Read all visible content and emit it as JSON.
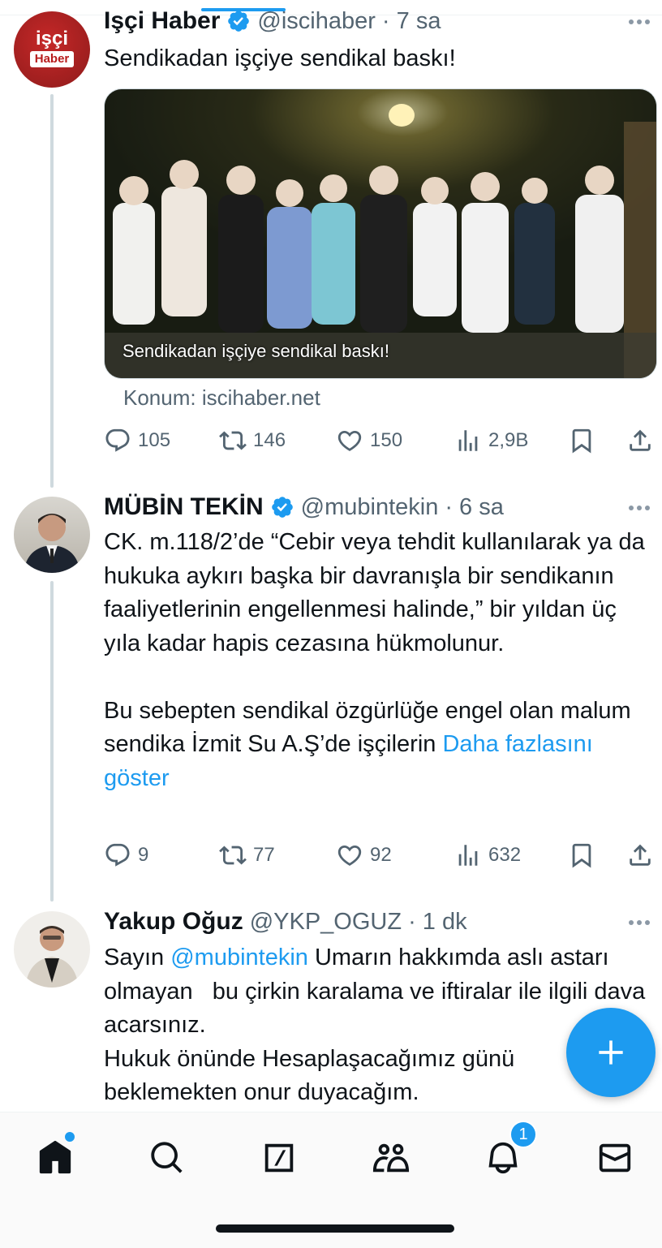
{
  "colors": {
    "accent": "#1d9bf0",
    "text": "#0f1419",
    "muted": "#536471",
    "verified": "#1d9bf0"
  },
  "tweets": [
    {
      "name": "Işçi Haber",
      "handle": "@iscihaber",
      "time": "· 7 sa",
      "avatar_text_1": "işçi",
      "avatar_text_2": "Haber",
      "text": "Sendikadan işçiye sendikal baskı!",
      "media_caption": "Sendikadan işçiye sendikal baskı!",
      "source": "Konum: iscihaber.net",
      "replies": "105",
      "retweets": "146",
      "likes": "150",
      "views": "2,9B"
    },
    {
      "name": "MÜBİN  TEKİN",
      "handle": "@mubintekin",
      "time": "· 6 sa",
      "text": "CK. m.118/2’de “Cebir veya tehdit kullanılarak ya da hukuka aykırı başka bir davranışla bir sendikanın faaliyetlerinin engellenmesi halinde,” bir yıldan üç yıla kadar hapis cezasına hükmolunur.\n\nBu sebepten sendikal özgürlüğe engel olan malum sendika İzmit Su A.Ş’de işçilerin ",
      "show_more": "Daha fazlasını göster",
      "replies": "9",
      "retweets": "77",
      "likes": "92",
      "views": "632"
    },
    {
      "name": "Yakup Oğuz",
      "handle": "@YKP_OGUZ",
      "time": "· 1 dk",
      "text_before": "Sayın ",
      "mention": "@mubintekin",
      "text_after": " Umarın hakkımda aslı astarı olmayan   bu çirkin karalama ve iftiralar ile ilgili dava acarsınız.\nHukuk önünde Hesaplaşacağımız günü beklemekten onur duyacağım."
    }
  ],
  "icons": {
    "reply": "reply-icon",
    "retweet": "retweet-icon",
    "like": "heart-icon",
    "views": "views-icon",
    "bookmark": "bookmark-icon",
    "share": "share-icon",
    "compose": "plus-icon"
  },
  "bottom_nav": {
    "items": [
      "home-icon",
      "search-icon",
      "grok-icon",
      "communities-icon",
      "notifications-icon",
      "messages-icon"
    ],
    "notifications_badge": "1"
  }
}
